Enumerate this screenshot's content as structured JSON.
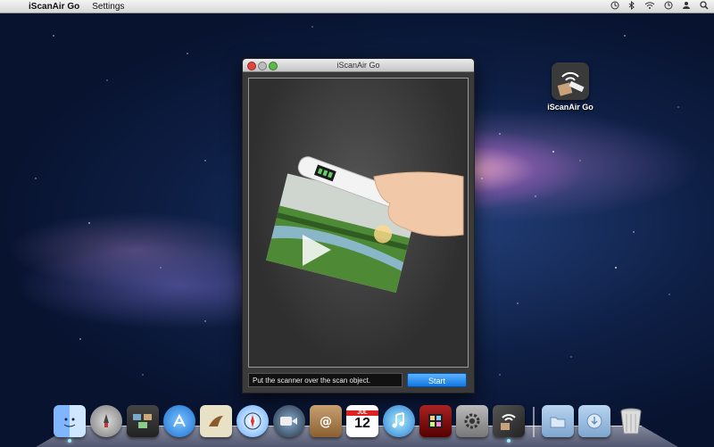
{
  "menubar": {
    "apple_symbol": "",
    "app_name": "iScanAir Go",
    "items": [
      "Settings"
    ]
  },
  "desktop": {
    "icon_label": "iScanAir Go"
  },
  "window": {
    "title": "iScanAir Go",
    "status_text": "Put the scanner over the scan object.",
    "start_label": "Start"
  },
  "dock": {
    "items": [
      {
        "name": "finder-icon",
        "label": "Finder"
      },
      {
        "name": "launchpad-icon",
        "label": "Launchpad"
      },
      {
        "name": "mission-control-icon",
        "label": "Mission Control"
      },
      {
        "name": "app-store-icon",
        "label": "App Store"
      },
      {
        "name": "mail-icon",
        "label": "Mail"
      },
      {
        "name": "safari-icon",
        "label": "Safari"
      },
      {
        "name": "facetime-icon",
        "label": "FaceTime"
      },
      {
        "name": "address-book-icon",
        "label": "Address Book"
      },
      {
        "name": "ical-icon",
        "label": "iCal"
      },
      {
        "name": "itunes-icon",
        "label": "iTunes"
      },
      {
        "name": "photo-booth-icon",
        "label": "Photo Booth"
      },
      {
        "name": "system-preferences-icon",
        "label": "System Preferences"
      },
      {
        "name": "iscanair-go-icon",
        "label": "iScanAir Go"
      }
    ],
    "calendar_day": "12",
    "calendar_month": "JUL"
  },
  "colors": {
    "accent": "#1177e0",
    "close": "#e0443b",
    "zoom": "#5cb84a"
  }
}
